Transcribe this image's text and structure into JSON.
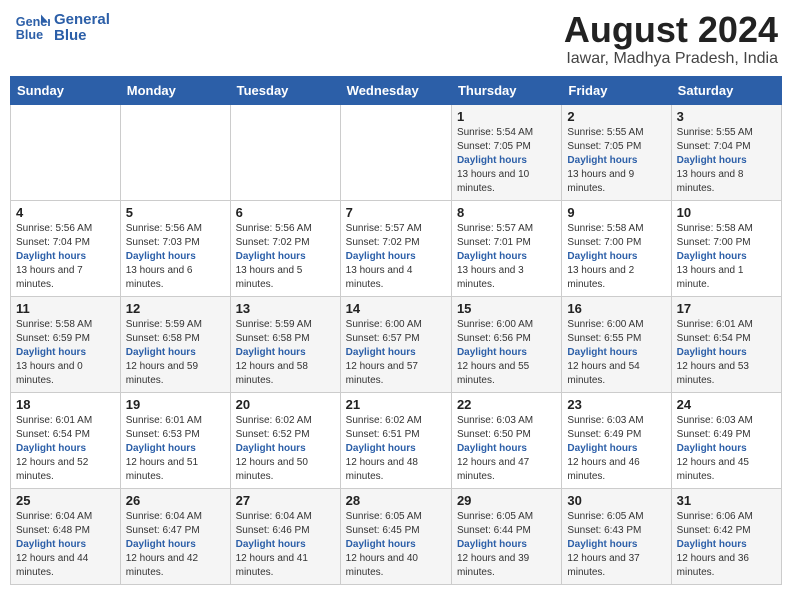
{
  "logo": {
    "line1": "General",
    "line2": "Blue"
  },
  "title": "August 2024",
  "subtitle": "Iawar, Madhya Pradesh, India",
  "days_of_week": [
    "Sunday",
    "Monday",
    "Tuesday",
    "Wednesday",
    "Thursday",
    "Friday",
    "Saturday"
  ],
  "weeks": [
    [
      {
        "day": "",
        "sunrise": "",
        "sunset": "",
        "daylight": ""
      },
      {
        "day": "",
        "sunrise": "",
        "sunset": "",
        "daylight": ""
      },
      {
        "day": "",
        "sunrise": "",
        "sunset": "",
        "daylight": ""
      },
      {
        "day": "",
        "sunrise": "",
        "sunset": "",
        "daylight": ""
      },
      {
        "day": "1",
        "sunrise": "5:54 AM",
        "sunset": "7:05 PM",
        "daylight": "13 hours and 10 minutes."
      },
      {
        "day": "2",
        "sunrise": "5:55 AM",
        "sunset": "7:05 PM",
        "daylight": "13 hours and 9 minutes."
      },
      {
        "day": "3",
        "sunrise": "5:55 AM",
        "sunset": "7:04 PM",
        "daylight": "13 hours and 8 minutes."
      }
    ],
    [
      {
        "day": "4",
        "sunrise": "5:56 AM",
        "sunset": "7:04 PM",
        "daylight": "13 hours and 7 minutes."
      },
      {
        "day": "5",
        "sunrise": "5:56 AM",
        "sunset": "7:03 PM",
        "daylight": "13 hours and 6 minutes."
      },
      {
        "day": "6",
        "sunrise": "5:56 AM",
        "sunset": "7:02 PM",
        "daylight": "13 hours and 5 minutes."
      },
      {
        "day": "7",
        "sunrise": "5:57 AM",
        "sunset": "7:02 PM",
        "daylight": "13 hours and 4 minutes."
      },
      {
        "day": "8",
        "sunrise": "5:57 AM",
        "sunset": "7:01 PM",
        "daylight": "13 hours and 3 minutes."
      },
      {
        "day": "9",
        "sunrise": "5:58 AM",
        "sunset": "7:00 PM",
        "daylight": "13 hours and 2 minutes."
      },
      {
        "day": "10",
        "sunrise": "5:58 AM",
        "sunset": "7:00 PM",
        "daylight": "13 hours and 1 minute."
      }
    ],
    [
      {
        "day": "11",
        "sunrise": "5:58 AM",
        "sunset": "6:59 PM",
        "daylight": "13 hours and 0 minutes."
      },
      {
        "day": "12",
        "sunrise": "5:59 AM",
        "sunset": "6:58 PM",
        "daylight": "12 hours and 59 minutes."
      },
      {
        "day": "13",
        "sunrise": "5:59 AM",
        "sunset": "6:58 PM",
        "daylight": "12 hours and 58 minutes."
      },
      {
        "day": "14",
        "sunrise": "6:00 AM",
        "sunset": "6:57 PM",
        "daylight": "12 hours and 57 minutes."
      },
      {
        "day": "15",
        "sunrise": "6:00 AM",
        "sunset": "6:56 PM",
        "daylight": "12 hours and 55 minutes."
      },
      {
        "day": "16",
        "sunrise": "6:00 AM",
        "sunset": "6:55 PM",
        "daylight": "12 hours and 54 minutes."
      },
      {
        "day": "17",
        "sunrise": "6:01 AM",
        "sunset": "6:54 PM",
        "daylight": "12 hours and 53 minutes."
      }
    ],
    [
      {
        "day": "18",
        "sunrise": "6:01 AM",
        "sunset": "6:54 PM",
        "daylight": "12 hours and 52 minutes."
      },
      {
        "day": "19",
        "sunrise": "6:01 AM",
        "sunset": "6:53 PM",
        "daylight": "12 hours and 51 minutes."
      },
      {
        "day": "20",
        "sunrise": "6:02 AM",
        "sunset": "6:52 PM",
        "daylight": "12 hours and 50 minutes."
      },
      {
        "day": "21",
        "sunrise": "6:02 AM",
        "sunset": "6:51 PM",
        "daylight": "12 hours and 48 minutes."
      },
      {
        "day": "22",
        "sunrise": "6:03 AM",
        "sunset": "6:50 PM",
        "daylight": "12 hours and 47 minutes."
      },
      {
        "day": "23",
        "sunrise": "6:03 AM",
        "sunset": "6:49 PM",
        "daylight": "12 hours and 46 minutes."
      },
      {
        "day": "24",
        "sunrise": "6:03 AM",
        "sunset": "6:49 PM",
        "daylight": "12 hours and 45 minutes."
      }
    ],
    [
      {
        "day": "25",
        "sunrise": "6:04 AM",
        "sunset": "6:48 PM",
        "daylight": "12 hours and 44 minutes."
      },
      {
        "day": "26",
        "sunrise": "6:04 AM",
        "sunset": "6:47 PM",
        "daylight": "12 hours and 42 minutes."
      },
      {
        "day": "27",
        "sunrise": "6:04 AM",
        "sunset": "6:46 PM",
        "daylight": "12 hours and 41 minutes."
      },
      {
        "day": "28",
        "sunrise": "6:05 AM",
        "sunset": "6:45 PM",
        "daylight": "12 hours and 40 minutes."
      },
      {
        "day": "29",
        "sunrise": "6:05 AM",
        "sunset": "6:44 PM",
        "daylight": "12 hours and 39 minutes."
      },
      {
        "day": "30",
        "sunrise": "6:05 AM",
        "sunset": "6:43 PM",
        "daylight": "12 hours and 37 minutes."
      },
      {
        "day": "31",
        "sunrise": "6:06 AM",
        "sunset": "6:42 PM",
        "daylight": "12 hours and 36 minutes."
      }
    ]
  ],
  "labels": {
    "sunrise_prefix": "Sunrise: ",
    "sunset_prefix": "Sunset: ",
    "daylight_prefix": "Daylight: "
  }
}
